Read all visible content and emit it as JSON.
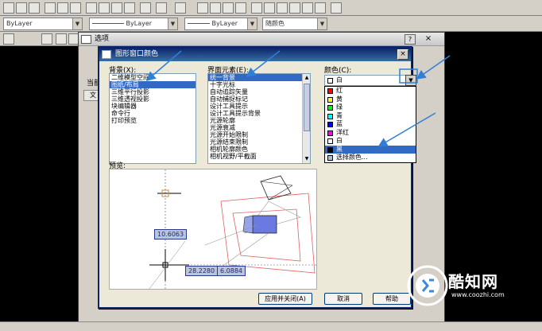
{
  "toolbar": {
    "layer_combo": "ByLayer",
    "linetype_combo": "ByLayer",
    "lineweight_combo": "ByLayer",
    "color_combo": "随颜色"
  },
  "options_window": {
    "title": "选项",
    "help_glyph": "?",
    "close_glyph": "×",
    "current_label": "当前",
    "tab_label": "文"
  },
  "dialog": {
    "title": "图形窗口颜色",
    "close_glyph": "×",
    "context_label": "背景(X):",
    "context_items": [
      "二维模型空间",
      "图纸/布局",
      "三维平行投影",
      "三维透视投影",
      "块编辑器",
      "命令行",
      "打印预览"
    ],
    "context_selected": 1,
    "element_label": "界面元素(E):",
    "element_items": [
      "统一背景",
      "十字光标",
      "自动追踪矢量",
      "自动捕捉标记",
      "设计工具提示",
      "设计工具提示背景",
      "光源轮廓",
      "光源衰减",
      "光源开始限制",
      "光源结束限制",
      "相机轮廓颜色",
      "相机视野/平截面"
    ],
    "element_selected": 0,
    "color_label": "颜色(C):",
    "color_selected": "白",
    "color_items": [
      {
        "name": "红",
        "color": "#ff0000"
      },
      {
        "name": "黄",
        "color": "#ffff00"
      },
      {
        "name": "绿",
        "color": "#00ff00"
      },
      {
        "name": "青",
        "color": "#00ffff"
      },
      {
        "name": "蓝",
        "color": "#0000ff"
      },
      {
        "name": "洋红",
        "color": "#ff00ff"
      },
      {
        "name": "白",
        "color": "#ffffff"
      },
      {
        "name": "黑",
        "color": "#000000"
      },
      {
        "name": "选择颜色...",
        "color": "#a0c0e0"
      }
    ],
    "color_highlighted": 7,
    "preview_label": "预览:",
    "coord_y": "10.6063",
    "coord_x1": "28.2280",
    "coord_x2": "6.0884",
    "buttons": {
      "apply_close": "应用并关闭(A)",
      "cancel": "取消",
      "help": "帮助"
    }
  },
  "watermark": {
    "text": "酷知网",
    "url": "www.coozhi.com"
  },
  "colors": {
    "annotation": "#2f7fd8",
    "selection": "#316ac5",
    "title_bar": "#0a246a"
  }
}
